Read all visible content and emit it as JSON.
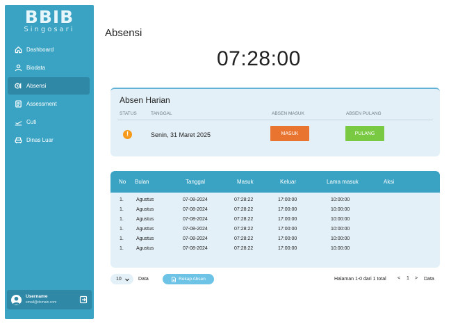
{
  "app": {
    "logo_main": "BBIB",
    "logo_sub": "Singosari"
  },
  "sidebar": {
    "items": [
      {
        "label": "Dashboard",
        "icon": "home-icon"
      },
      {
        "label": "Biodata",
        "icon": "user-icon"
      },
      {
        "label": "Absensi",
        "icon": "clock-icon",
        "active": true
      },
      {
        "label": "Assessment",
        "icon": "document-icon"
      },
      {
        "label": "Cuti",
        "icon": "airplane-icon"
      },
      {
        "label": "Dinas Luar",
        "icon": "car-icon"
      }
    ],
    "user": {
      "name": "Username",
      "email": "email@domain.com"
    }
  },
  "header": {
    "title": "Absensi",
    "clock": "07:28:00"
  },
  "harian": {
    "title": "Absen Harian",
    "col_status": "STATUS",
    "col_tanggal": "TANGGAL",
    "col_masuk": "ABSEN MASUK",
    "col_pulang": "ABSEN PULANG",
    "status_symbol": "!",
    "date": "Senin, 31 Maret 2025",
    "btn_masuk": "MASUK",
    "btn_pulang": "PULANG"
  },
  "table": {
    "headers": [
      "No",
      "Bulan",
      "Tanggal",
      "Masuk",
      "Keluar",
      "Lama masuk",
      "Aksi"
    ],
    "rows": [
      [
        "1.",
        "Agustus",
        "07-08-2024",
        "07:28:22",
        "17:00:00",
        "10:00:00"
      ],
      [
        "1.",
        "Agustus",
        "07-08-2024",
        "07:28:22",
        "17:00:00",
        "10:00:00"
      ],
      [
        "1.",
        "Agustus",
        "07-08-2024",
        "07:28:22",
        "17:00:00",
        "10:00:00"
      ],
      [
        "1.",
        "Agustus",
        "07-08-2024",
        "07:28:22",
        "17:00:00",
        "10:00:00"
      ],
      [
        "1.",
        "Agustus",
        "07-08-2024",
        "07:28:22",
        "17:00:00",
        "10:00:00"
      ],
      [
        "1.",
        "Agustus",
        "07-08-2024",
        "07:28:22",
        "17:00:00",
        "10:00:00"
      ]
    ]
  },
  "pager": {
    "per_page": "10",
    "data_label": "Data",
    "rekap_label": "Rekap Absen",
    "page_info": "Halaman 1-0 dari 1 total",
    "prev": "<",
    "current_page": "1",
    "next": ">",
    "data_label_right": "Data"
  },
  "colors": {
    "primary": "#3aa3c3",
    "sidebar_active": "#2f88a5",
    "card_bg": "#e4f0f7",
    "masuk": "#e8742f",
    "pulang": "#7ac943",
    "warning": "#f59a1b",
    "rekap": "#6cc3e6"
  }
}
